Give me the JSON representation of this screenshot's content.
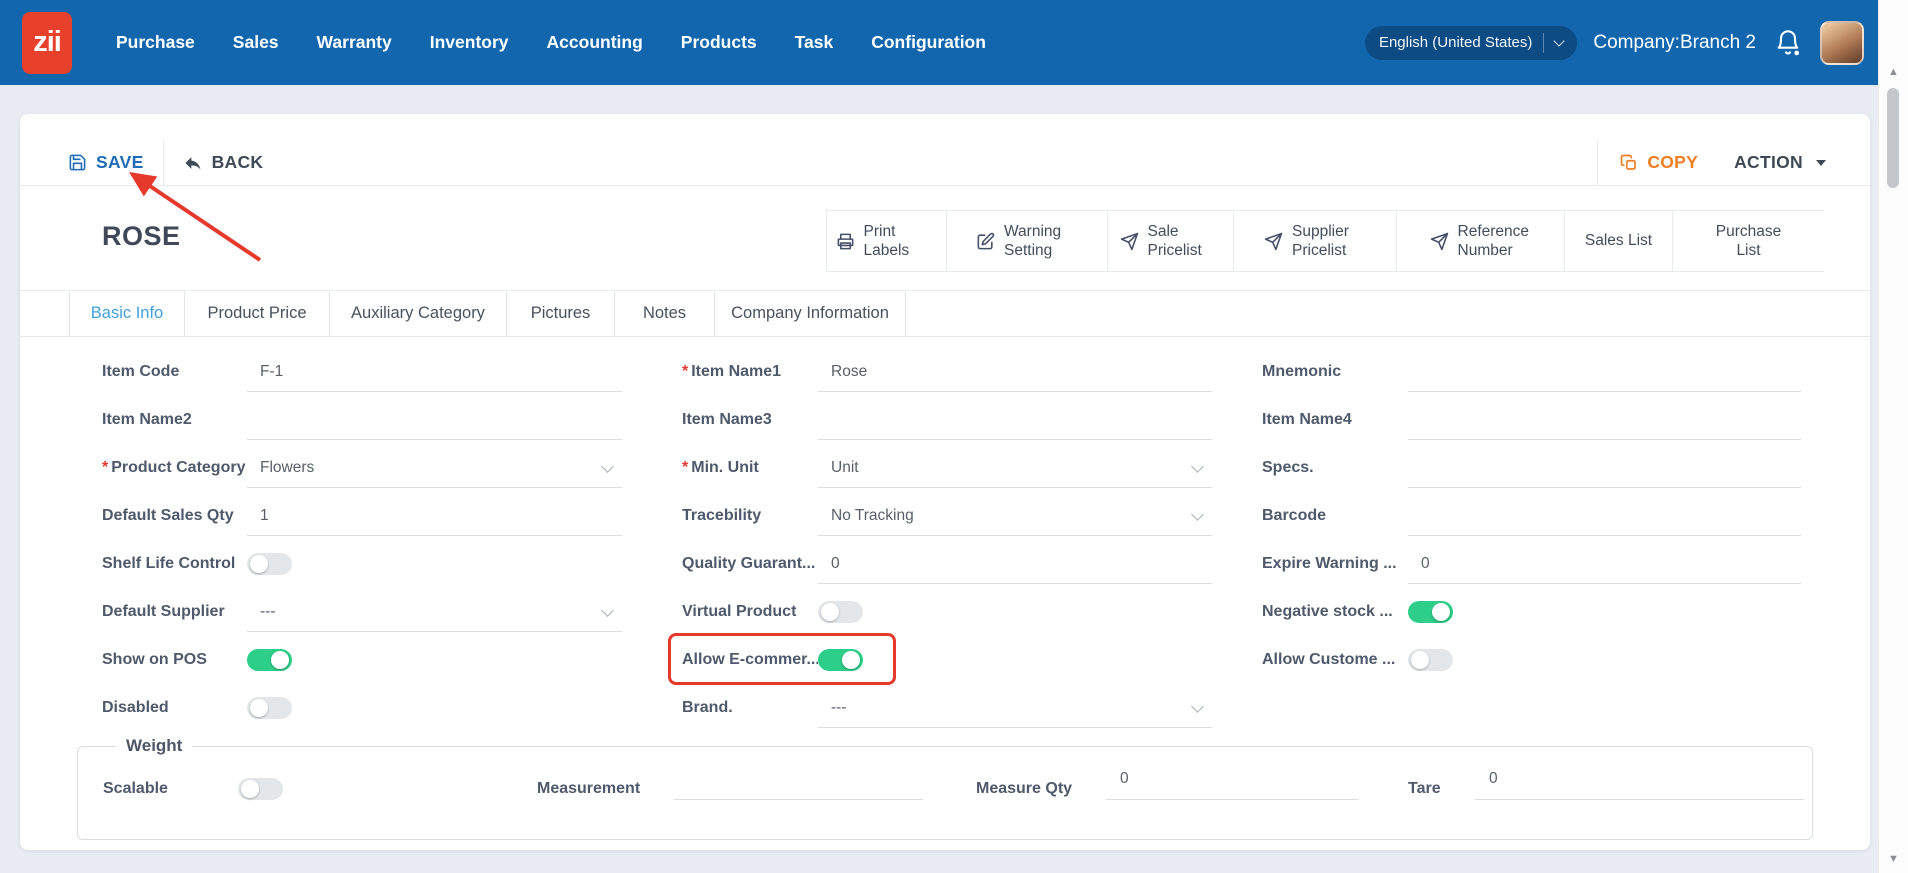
{
  "topnav": {
    "logo_text": "zii",
    "items": [
      "Purchase",
      "Sales",
      "Warranty",
      "Inventory",
      "Accounting",
      "Products",
      "Task",
      "Configuration"
    ],
    "language_selector": "English (United States)",
    "company_label": "Company:Branch 2"
  },
  "toolbar": {
    "save": "SAVE",
    "back": "BACK",
    "copy": "COPY",
    "action": "ACTION"
  },
  "product": {
    "title": "ROSE"
  },
  "quick_actions": [
    {
      "label": "Print Labels",
      "icon": "print-icon"
    },
    {
      "label": "Warning Setting",
      "icon": "edit-icon"
    },
    {
      "label": "Sale Pricelist",
      "icon": "send-icon"
    },
    {
      "label": "Supplier Pricelist",
      "icon": "send-icon"
    },
    {
      "label": "Reference Number",
      "icon": "send-icon"
    },
    {
      "label": "Sales List",
      "icon": ""
    },
    {
      "label": "Purchase List",
      "icon": ""
    }
  ],
  "tabs": [
    {
      "label": "Basic Info",
      "active": true
    },
    {
      "label": "Product Price",
      "active": false
    },
    {
      "label": "Auxiliary Category",
      "active": false
    },
    {
      "label": "Pictures",
      "active": false
    },
    {
      "label": "Notes",
      "active": false
    },
    {
      "label": "Company Information",
      "active": false
    }
  ],
  "form": {
    "rows": [
      {
        "fields": [
          {
            "label": "Item Code",
            "type": "text",
            "value": "F-1",
            "required": false
          },
          {
            "label": "Item Name1",
            "type": "text",
            "value": "Rose",
            "required": true
          },
          {
            "label": "Mnemonic",
            "type": "text",
            "value": "",
            "required": false
          }
        ]
      },
      {
        "fields": [
          {
            "label": "Item Name2",
            "type": "text",
            "value": "",
            "required": false
          },
          {
            "label": "Item Name3",
            "type": "text",
            "value": "",
            "required": false
          },
          {
            "label": "Item Name4",
            "type": "text",
            "value": "",
            "required": false
          }
        ]
      },
      {
        "fields": [
          {
            "label": "Product Category",
            "type": "select",
            "value": "Flowers",
            "required": true
          },
          {
            "label": "Min. Unit",
            "type": "select",
            "value": "Unit",
            "required": true
          },
          {
            "label": "Specs.",
            "type": "text",
            "value": "",
            "required": false
          }
        ]
      },
      {
        "fields": [
          {
            "label": "Default Sales Qty",
            "type": "text",
            "value": "1",
            "required": false
          },
          {
            "label": "Tracebility",
            "type": "select",
            "value": "No Tracking",
            "required": false
          },
          {
            "label": "Barcode",
            "type": "text",
            "value": "",
            "required": false
          }
        ]
      },
      {
        "fields": [
          {
            "label": "Shelf Life Control",
            "type": "toggle",
            "state": "off",
            "required": false
          },
          {
            "label": "Quality Guarant...",
            "type": "text",
            "value": "0",
            "required": false
          },
          {
            "label": "Expire Warning ...",
            "type": "text",
            "value": "0",
            "required": false
          }
        ]
      },
      {
        "fields": [
          {
            "label": "Default Supplier",
            "type": "select",
            "value": "---",
            "required": false
          },
          {
            "label": "Virtual Product",
            "type": "toggle",
            "state": "off",
            "required": false
          },
          {
            "label": "Negative stock ...",
            "type": "toggle",
            "state": "on",
            "required": false
          }
        ]
      },
      {
        "fields": [
          {
            "label": "Show on POS",
            "type": "toggle",
            "state": "on",
            "required": false
          },
          {
            "label": "Allow E-commer...",
            "type": "toggle",
            "state": "on",
            "required": false
          },
          {
            "label": "Allow Custome ...",
            "type": "toggle",
            "state": "off",
            "required": false
          }
        ]
      },
      {
        "fields": [
          {
            "label": "Disabled",
            "type": "toggle",
            "state": "off",
            "required": false
          },
          {
            "label": "Brand.",
            "type": "select",
            "value": "---",
            "required": false
          }
        ]
      }
    ]
  },
  "weight_section": {
    "legend": "Weight",
    "fields": [
      {
        "label": "Scalable",
        "type": "toggle",
        "state": "off"
      },
      {
        "label": "Measurement",
        "type": "text",
        "value": ""
      },
      {
        "label": "Measure Qty",
        "type": "text",
        "value": "0"
      },
      {
        "label": "Tare",
        "type": "text",
        "value": "0"
      }
    ]
  },
  "annotations": {
    "color": "#e5392c",
    "arrow_points_to": "SAVE button",
    "box_highlights": "Allow E-commerce toggle"
  },
  "colors": {
    "nav_bg": "#1166ad",
    "logo_bg": "#e8412b",
    "accent_blue": "#1e6cb8",
    "accent_orange": "#ef7e23",
    "active_tab": "#41a0d9",
    "toggle_on": "#2dce89",
    "page_bg": "#e9edf3"
  }
}
